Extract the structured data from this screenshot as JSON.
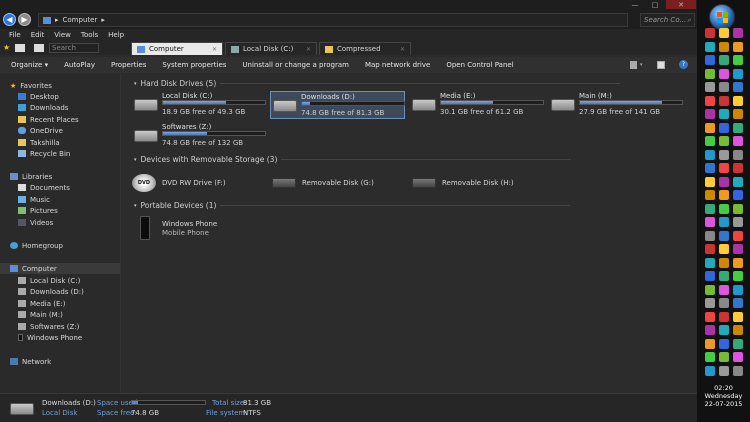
{
  "window": {
    "address_path": "Computer",
    "address_arrow": "▸",
    "search_placeholder": "Search Co...",
    "controls": [
      "—",
      "□",
      "✕"
    ]
  },
  "menu": [
    "File",
    "Edit",
    "View",
    "Tools",
    "Help"
  ],
  "quick_search_placeholder": "Search",
  "tabs": [
    {
      "label": "Computer",
      "active": true
    },
    {
      "label": "Local Disk (C:)",
      "active": false
    },
    {
      "label": "Compressed",
      "active": false
    }
  ],
  "commands": [
    "Organize ▾",
    "AutoPlay",
    "Properties",
    "System properties",
    "Uninstall or change a program",
    "Map network drive",
    "Open Control Panel"
  ],
  "command_icons": [
    "view-icon",
    "pane-icon",
    "help-icon"
  ],
  "nav": {
    "favorites": {
      "label": "Favorites",
      "items": [
        "Desktop",
        "Downloads",
        "Recent Places",
        "OneDrive",
        "Takshilla",
        "Recycle Bin"
      ]
    },
    "libraries": {
      "label": "Libraries",
      "items": [
        "Documents",
        "Music",
        "Pictures",
        "Videos"
      ]
    },
    "homegroup": "Homegroup",
    "computer": {
      "label": "Computer",
      "items": [
        "Local Disk (C:)",
        "Downloads (D:)",
        "Media (E:)",
        "Main (M:)",
        "Softwares (Z:)",
        "Windows Phone"
      ]
    },
    "network": "Network"
  },
  "groups": {
    "hdd": "Hard Disk Drives (5)",
    "removable": "Devices with Removable Storage (3)",
    "portable": "Portable Devices (1)"
  },
  "drives": [
    {
      "name": "Local Disk (C:)",
      "info": "18.9 GB free of 49.3 GB",
      "used_fraction": 0.62
    },
    {
      "name": "Downloads (D:)",
      "info": "74.8 GB free of 81.3 GB",
      "used_fraction": 0.08
    },
    {
      "name": "Media (E:)",
      "info": "30.1 GB free of 61.2 GB",
      "used_fraction": 0.51
    },
    {
      "name": "Main (M:)",
      "info": "27.9 GB free of 141 GB",
      "used_fraction": 0.8
    },
    {
      "name": "Softwares (Z:)",
      "info": "74.8 GB free of 132 GB",
      "used_fraction": 0.43
    }
  ],
  "removable": [
    {
      "name": "DVD RW Drive (F:)",
      "badge": "DVD"
    },
    {
      "name": "Removable Disk (G:)"
    },
    {
      "name": "Removable Disk (H:)"
    }
  ],
  "portable": {
    "name": "Windows Phone",
    "type": "Mobile Phone"
  },
  "status": {
    "name": "Downloads (D:)",
    "type": "Local Disk",
    "space_used_label": "Space used:",
    "space_free_label": "Space free:",
    "space_free": "74.8 GB",
    "total_label": "Total size:",
    "total": "81.3 GB",
    "fs_label": "File system:",
    "fs": "NTFS",
    "used_fraction": 0.08
  },
  "clock": {
    "time": "02:20",
    "day": "Wednesday",
    "date": "22-07-2015"
  }
}
